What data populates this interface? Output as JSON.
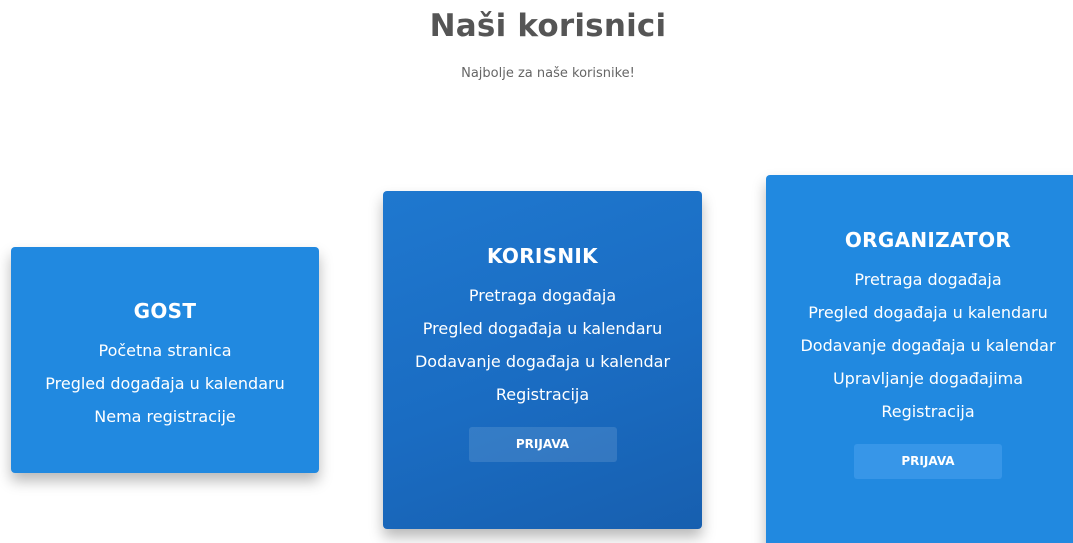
{
  "header": {
    "title": "Naši korisnici",
    "subtitle": "Najbolje za naše korisnike!"
  },
  "cards": [
    {
      "title": "GOST",
      "features": [
        "Početna stranica",
        "Pregled događaja u kalendaru",
        "Nema registracije"
      ]
    },
    {
      "title": "KORISNIK",
      "features": [
        "Pretraga događaja",
        "Pregled događaja u kalendaru",
        "Dodavanje događaja u kalendar",
        "Registracija"
      ],
      "button_label": "PRIJAVA"
    },
    {
      "title": "ORGANIZATOR",
      "features": [
        "Pretraga događaja",
        "Pregled događaja u kalendaru",
        "Dodavanje događaja u kalendar",
        "Upravljanje događajima",
        "Registracija"
      ],
      "button_label": "PRIJAVA"
    }
  ],
  "colors": {
    "card_blue": "#2189e0",
    "card_dark_blue": "#1a6cc2",
    "title_gray": "#555555"
  }
}
